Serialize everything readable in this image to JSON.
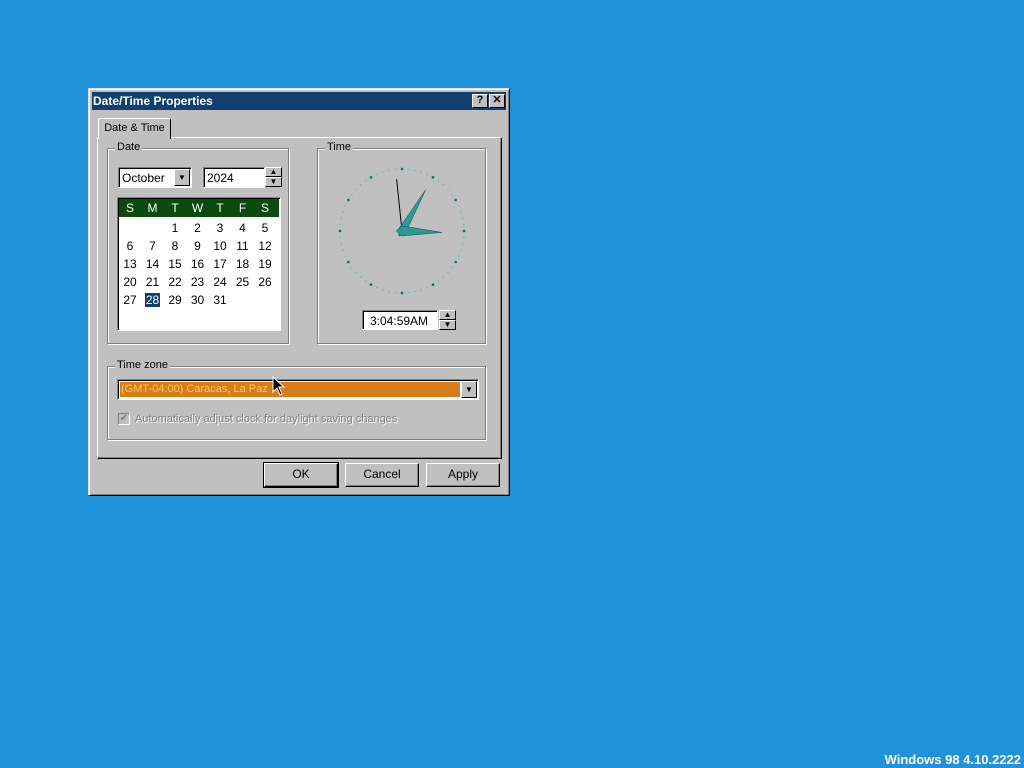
{
  "window": {
    "title": "Date/Time Properties",
    "help_button": "?",
    "close_button": "✕"
  },
  "tab": {
    "label": "Date & Time"
  },
  "date": {
    "group_label": "Date",
    "month": "October",
    "year": "2024",
    "weekday_headers": [
      "S",
      "M",
      "T",
      "W",
      "T",
      "F",
      "S"
    ],
    "weeks": [
      [
        "",
        "",
        "1",
        "2",
        "3",
        "4",
        "5"
      ],
      [
        "6",
        "7",
        "8",
        "9",
        "10",
        "11",
        "12"
      ],
      [
        "13",
        "14",
        "15",
        "16",
        "17",
        "18",
        "19"
      ],
      [
        "20",
        "21",
        "22",
        "23",
        "24",
        "25",
        "26"
      ],
      [
        "27",
        "28",
        "29",
        "30",
        "31",
        "",
        ""
      ]
    ],
    "selected_day": "28"
  },
  "time": {
    "group_label": "Time",
    "value": "3:04:59AM",
    "clock": {
      "hour": 3,
      "minute": 4,
      "second": 59
    }
  },
  "timezone": {
    "group_label": "Time zone",
    "selected": "(GMT-04:00) Caracas, La Paz",
    "dst_label": "Automatically adjust clock for daylight saving changes",
    "dst_checked": true
  },
  "buttons": {
    "ok": "OK",
    "cancel": "Cancel",
    "apply": "Apply"
  },
  "desktop": {
    "version_text": "Windows 98 4.10.2222"
  },
  "colors": {
    "desktop": "#2092dc",
    "titlebar": "#10406e",
    "calendar_header": "#0a4a0a",
    "timezone_highlight": "#d97d1c",
    "clock_hands": "#2a9a96"
  }
}
